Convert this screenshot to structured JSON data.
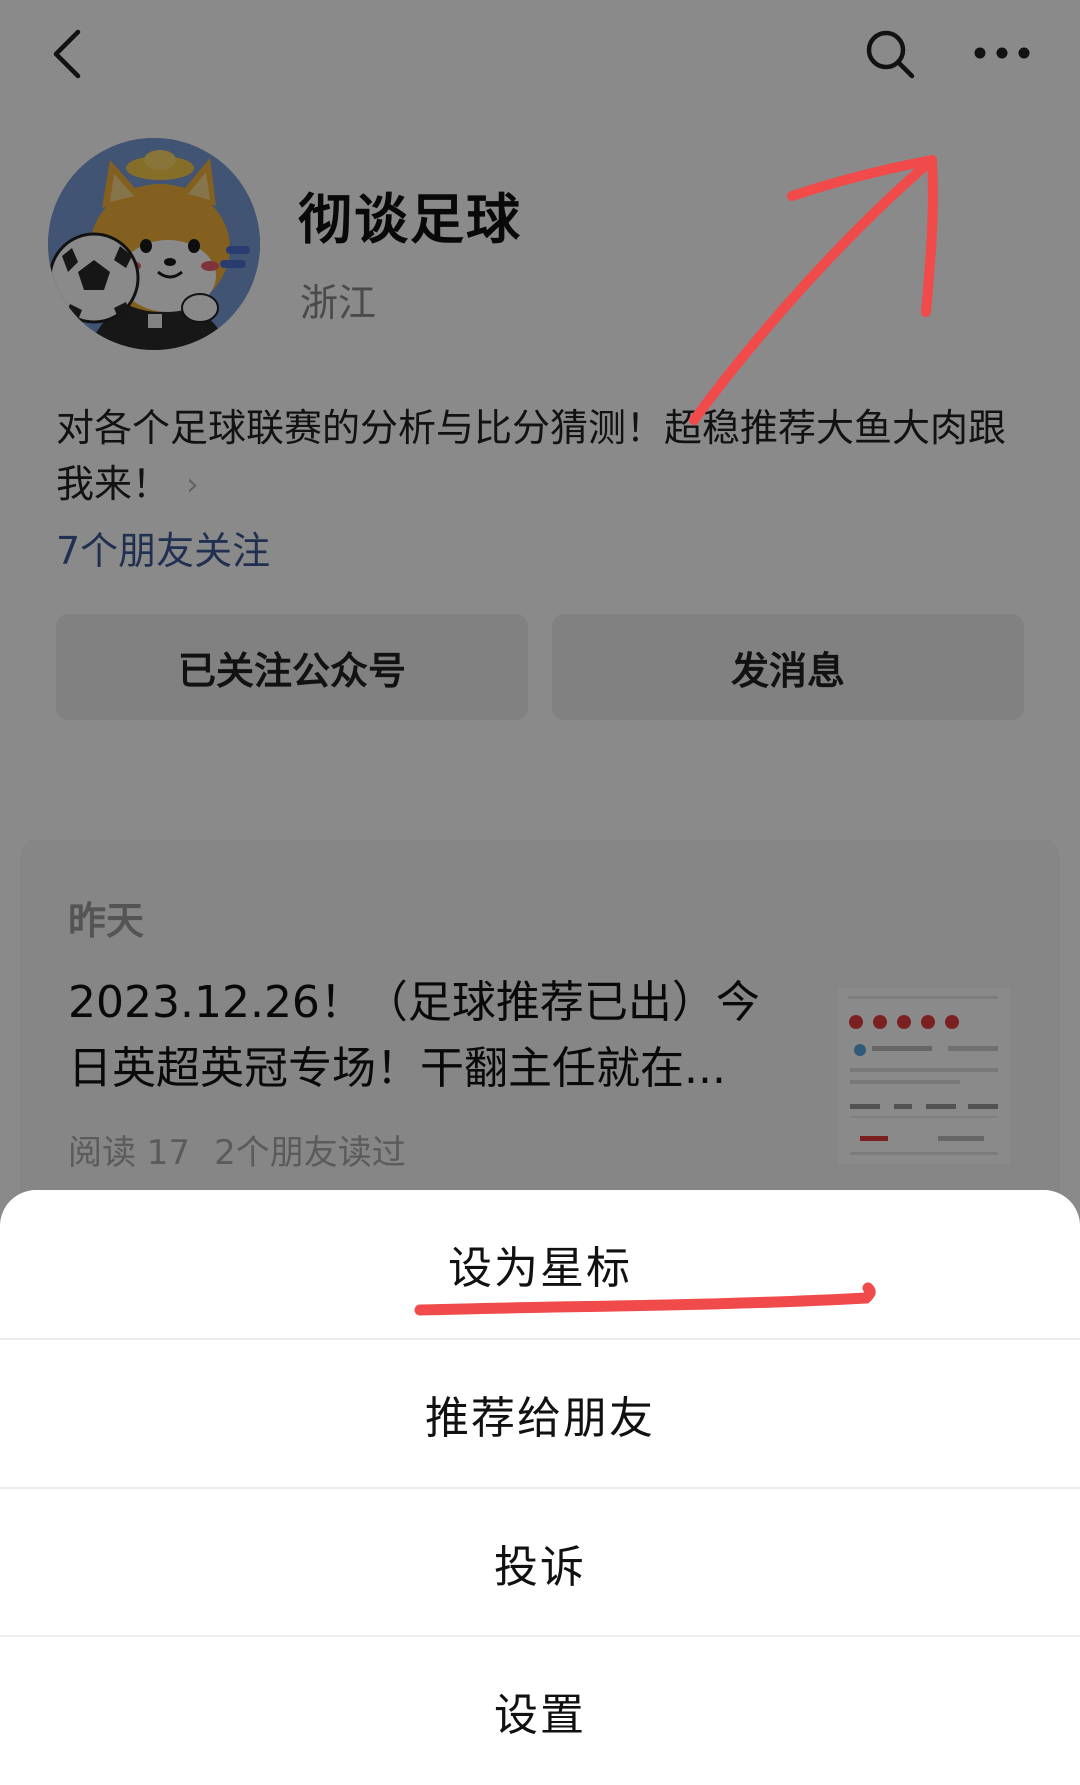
{
  "topbar": {
    "back_icon": "chevron-left-icon",
    "search_icon": "search-icon",
    "more_icon": "more-dots-icon"
  },
  "profile": {
    "name": "彻谈足球",
    "region": "浙江",
    "avatar_icon": "shiba-dog-soccer-avatar",
    "description": "对各个足球联赛的分析与比分猜测！超稳推荐大鱼大肉跟我来！",
    "description_chevron": "›",
    "friends_following": "7个朋友关注"
  },
  "actions": {
    "followed_label": "已关注公众号",
    "message_label": "发消息"
  },
  "article": {
    "date": "昨天",
    "title": "2023.12.26！（足球推荐已出）今日英超英冠专场！干翻主任就在...",
    "reads": "阅读 17",
    "friends_read": "2个朋友读过"
  },
  "action_sheet": {
    "items": [
      {
        "label": "设为星标"
      },
      {
        "label": "推荐给朋友"
      },
      {
        "label": "投诉"
      },
      {
        "label": "设置"
      }
    ]
  },
  "colors": {
    "annotation_red": "#f04a4a",
    "link_blue": "#3d5a96",
    "overlay": "rgba(0,0,0,0.46)"
  }
}
